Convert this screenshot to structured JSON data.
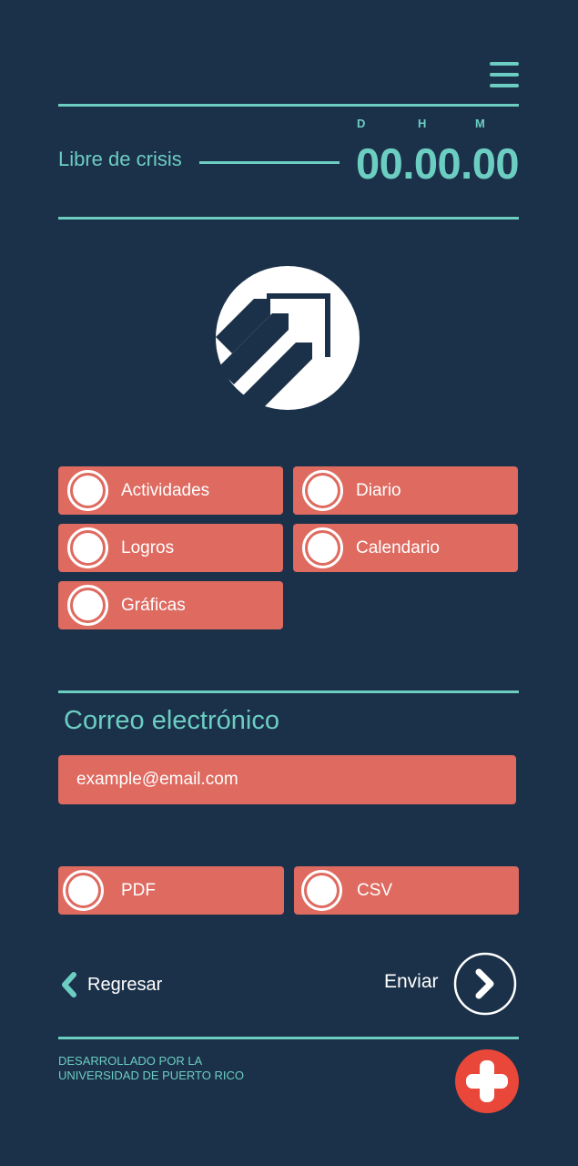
{
  "header": {
    "crisis_label": "Libre de crisis",
    "timer_units": {
      "days": "D",
      "hours": "H",
      "minutes": "M"
    },
    "timer_value": "00.00.00"
  },
  "options": {
    "actividades": "Actividades",
    "diario": "Diario",
    "logros": "Logros",
    "calendario": "Calendario",
    "graficas": "Gráficas"
  },
  "email": {
    "title": "Correo electrónico",
    "placeholder": "example@email.com"
  },
  "formats": {
    "pdf": "PDF",
    "csv": "CSV"
  },
  "nav": {
    "back_label": "Regresar",
    "send_label": "Enviar"
  },
  "footer": {
    "line1": "DESARROLLADO POR LA",
    "line2": "UNIVERSIDAD DE PUERTO RICO"
  },
  "colors": {
    "background": "#1b3149",
    "accent": "#6ccdc2",
    "button": "#de6a60",
    "fab": "#e8473a"
  },
  "icons": [
    "menu-icon",
    "app-logo",
    "chevron-left-icon",
    "chevron-right-icon",
    "plus-icon"
  ]
}
